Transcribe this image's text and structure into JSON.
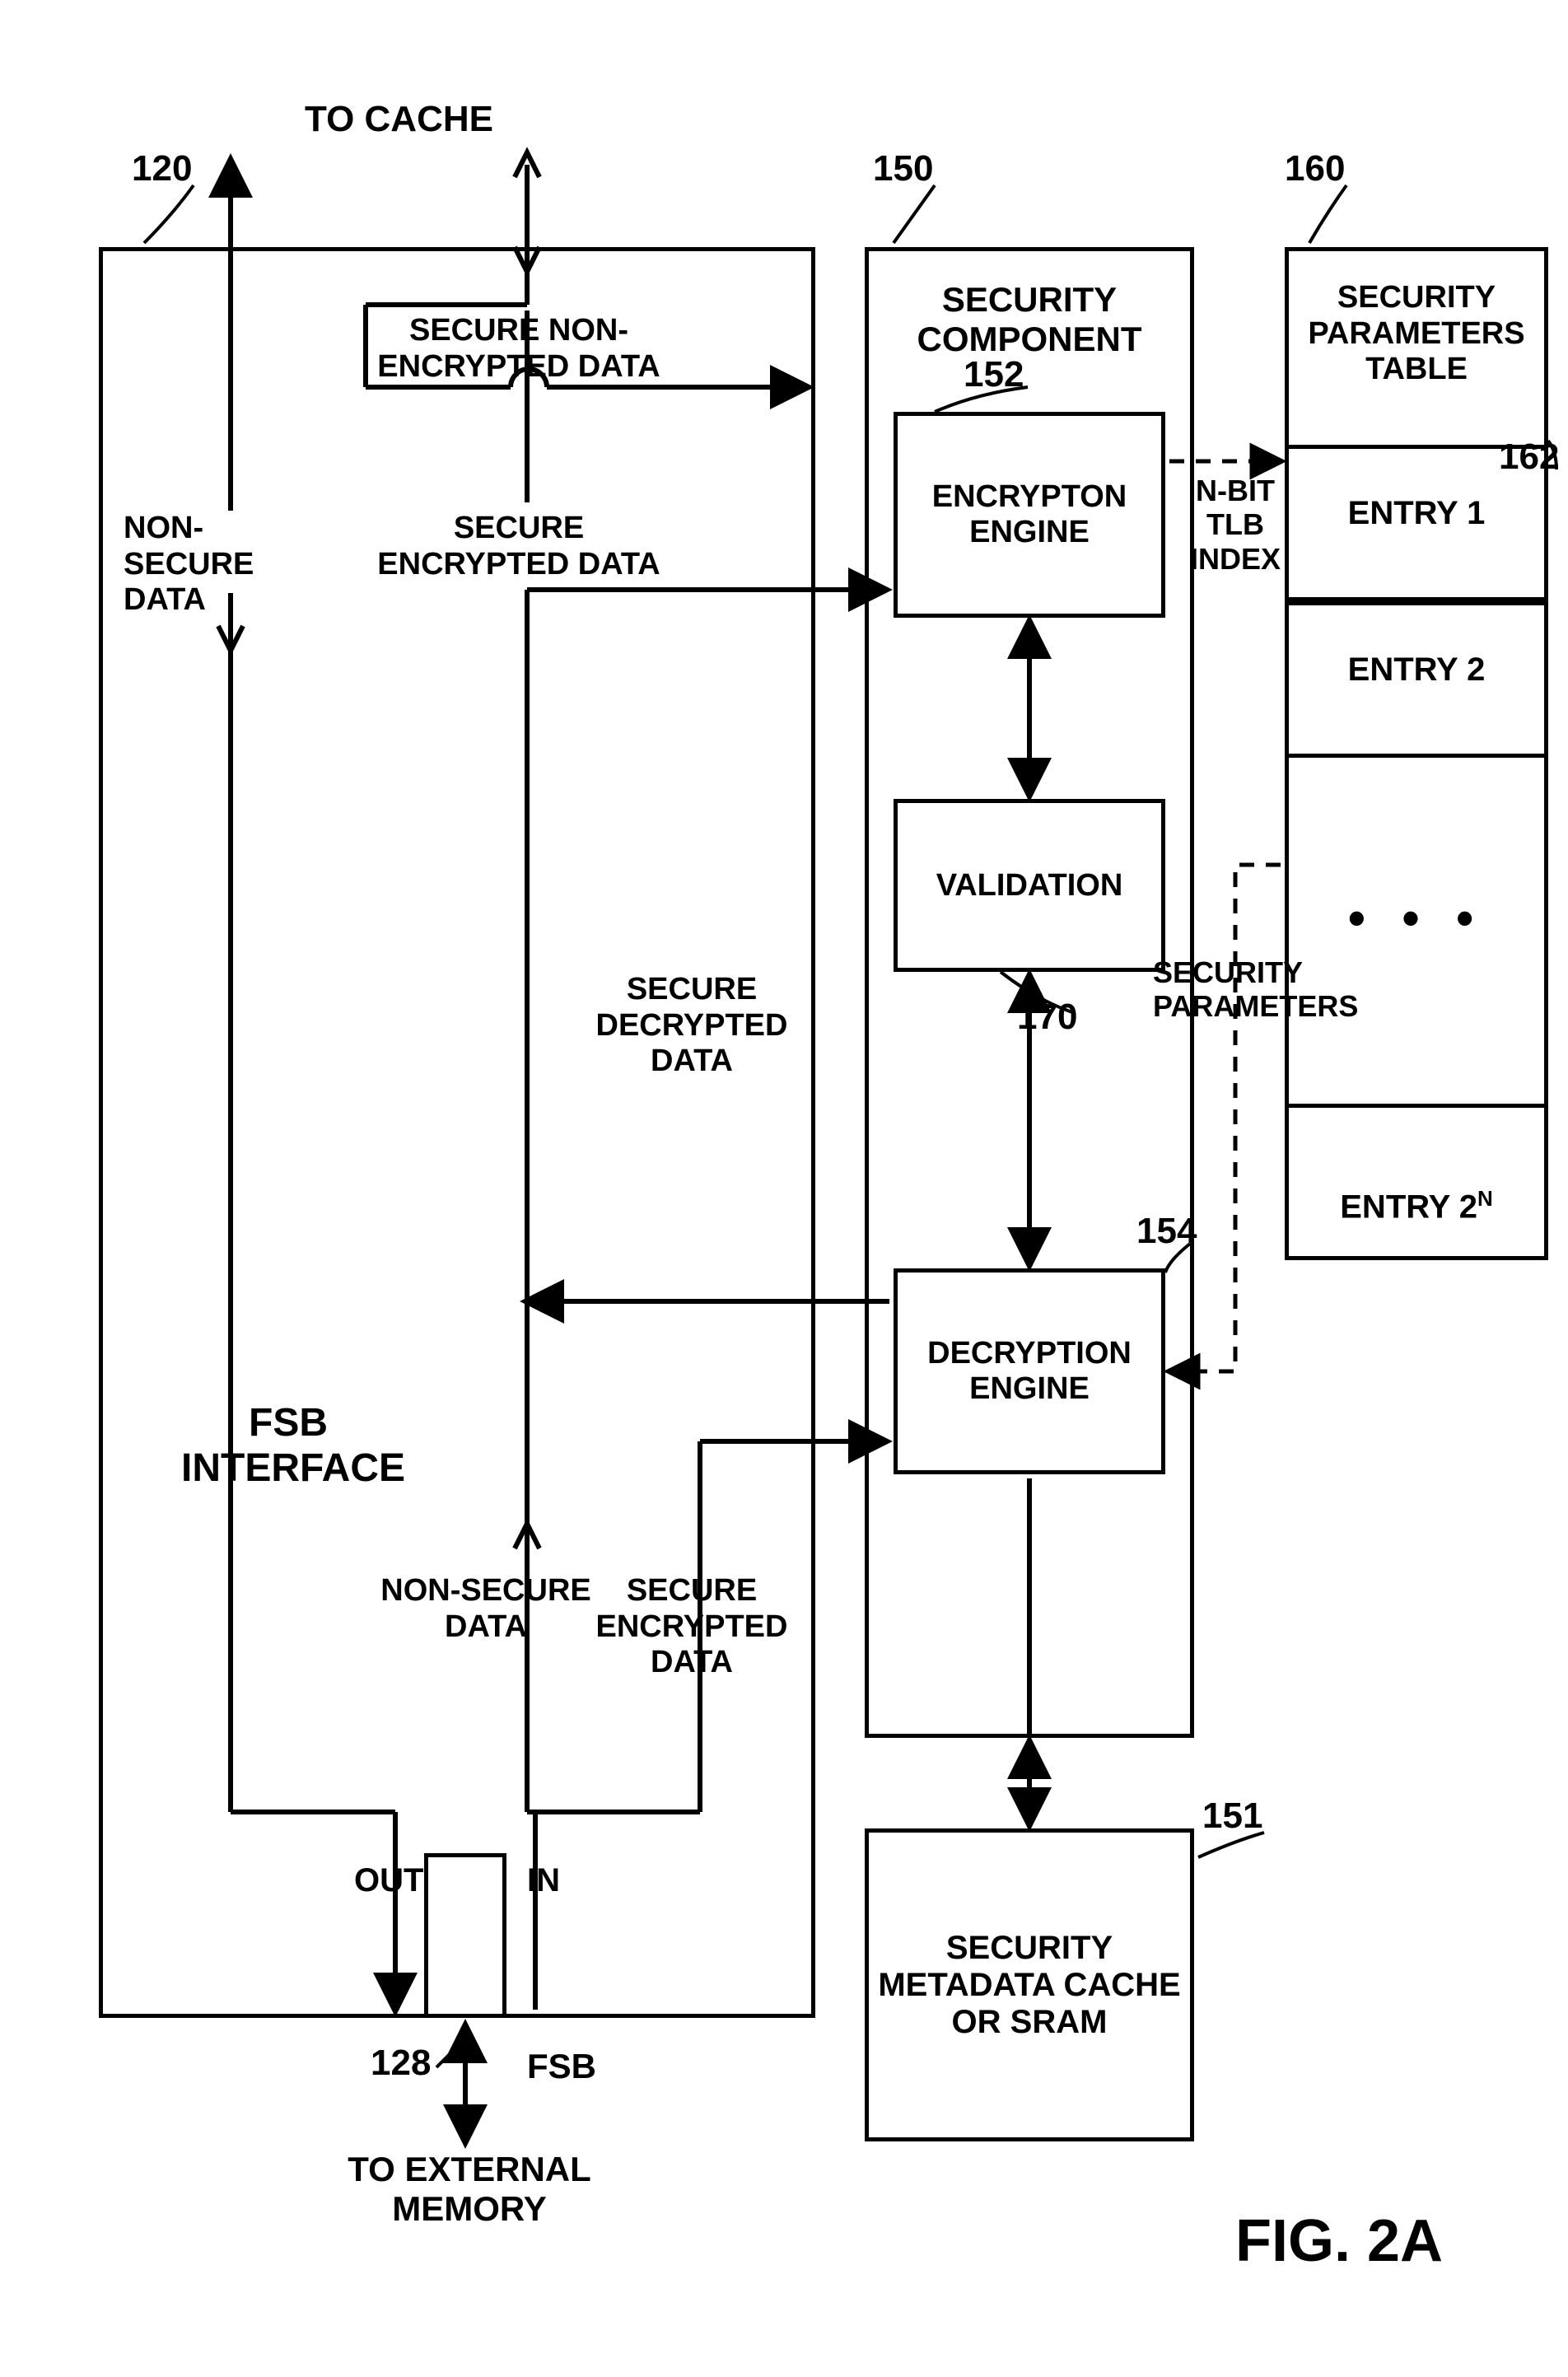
{
  "figure": "FIG. 2A",
  "fsb": {
    "ref": "120",
    "title": "FSB\nINTERFACE",
    "top_label": "TO CACHE",
    "nonsecure_data": "NON- SECURE\nDATA",
    "secure_nonenc": "SECURE NON-\nENCRYPTED DATA",
    "secure_enc": "SECURE\nENCRYPTED DATA",
    "nonsecure_data2": "NON-SECURE\nDATA",
    "secure_decrypted": "SECURE\nDECRYPTED\nDATA",
    "secure_encrypted_in": "SECURE\nENCRYPTED\nDATA",
    "out": "OUT",
    "in": "IN",
    "fsb_label": "FSB",
    "to_ext": "TO EXTERNAL\nMEMORY",
    "bus_ref": "128"
  },
  "sec": {
    "ref": "150",
    "title": "SECURITY\nCOMPONENT",
    "enc_engine": "ENCRYPTON\nENGINE",
    "enc_ref": "152",
    "validation": "VALIDATION",
    "val_ref": "170",
    "dec_engine": "DECRYPTION\nENGINE",
    "dec_ref": "154"
  },
  "meta": {
    "title": "SECURITY\nMETADATA\nCACHE OR\nSRAM",
    "ref": "151"
  },
  "table": {
    "ref": "160",
    "title": "SECURITY\nPARAMETERS\nTABLE",
    "entry1": "ENTRY 1",
    "entry2": "ENTRY 2",
    "dots": "• • •",
    "entryN": "ENTRY 2",
    "entryN_sup": "N",
    "ref2": "162"
  },
  "links": {
    "nbit": "N-BIT\nTLB\nINDEX",
    "sec_params": "SECURITY\nPARAMETERS"
  }
}
